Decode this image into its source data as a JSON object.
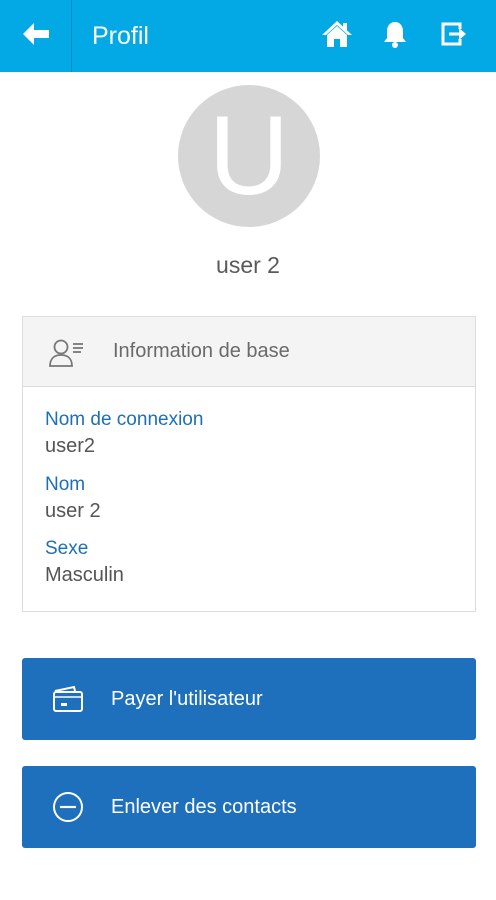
{
  "header": {
    "title": "Profil",
    "background": "#03a9e4",
    "icons": [
      "back-arrow-icon",
      "home-icon",
      "bell-icon",
      "logout-icon"
    ]
  },
  "profile": {
    "avatar_letter": "U",
    "username": "user 2"
  },
  "info_card": {
    "title": "Information de base",
    "icon": "contact-card-icon",
    "fields": [
      {
        "label": "Nom de connexion",
        "value": "user2"
      },
      {
        "label": "Nom",
        "value": "user 2"
      },
      {
        "label": "Sexe",
        "value": "Masculin"
      }
    ]
  },
  "actions": [
    {
      "label": "Payer l'utilisateur",
      "icon": "wallet-icon"
    },
    {
      "label": "Enlever des contacts",
      "icon": "minus-circle-icon"
    }
  ],
  "colors": {
    "accent": "#03a9e4",
    "button": "#1e6fbc",
    "label": "#1e6fb8"
  }
}
